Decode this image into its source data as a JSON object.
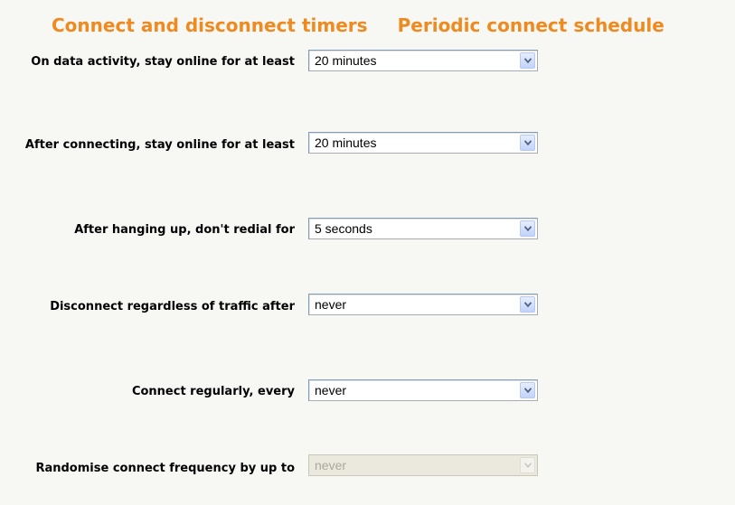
{
  "tabs": [
    {
      "label": "Connect and disconnect timers"
    },
    {
      "label": "Periodic connect schedule"
    }
  ],
  "settings": [
    {
      "label": "On data activity, stay online for at least",
      "value": "20 minutes",
      "enabled": true
    },
    {
      "label": "After connecting, stay online for at least",
      "value": "20 minutes",
      "enabled": true
    },
    {
      "label": "After hanging up, don't redial for",
      "value": "5 seconds",
      "enabled": true
    },
    {
      "label": "Disconnect regardless of traffic after",
      "value": "never",
      "enabled": true
    },
    {
      "label": "Connect regularly, every",
      "value": "never",
      "enabled": true
    },
    {
      "label": "Randomise connect frequency by up to",
      "value": "never",
      "enabled": false
    }
  ],
  "colors": {
    "heading": "#ee8a1f",
    "background": "#f7f7f4",
    "dropdown_arrow": "#4d6185"
  },
  "icons": {
    "dropdown": "chevron-down-icon"
  }
}
